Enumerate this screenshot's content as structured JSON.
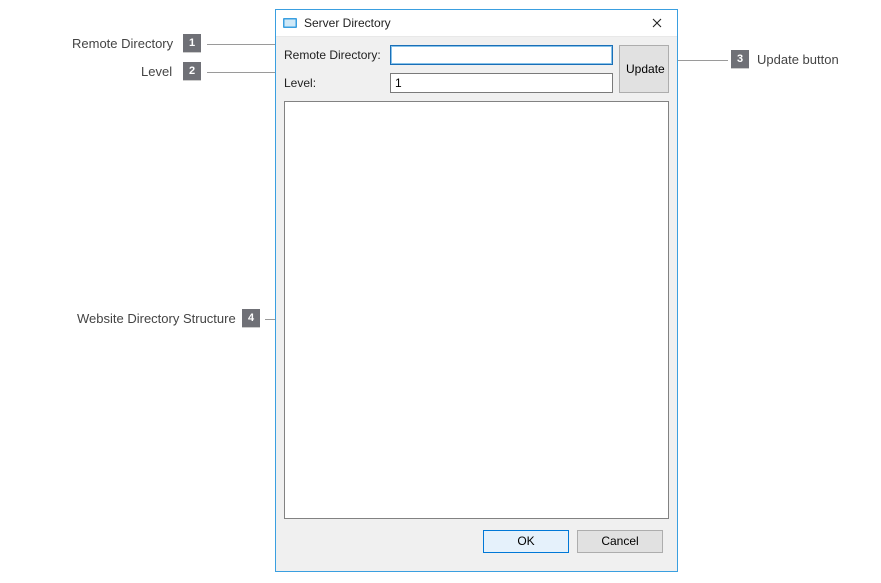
{
  "callouts": {
    "c1": {
      "num": "1",
      "label": "Remote Directory"
    },
    "c2": {
      "num": "2",
      "label": "Level"
    },
    "c3": {
      "num": "3",
      "label": "Update button"
    },
    "c4": {
      "num": "4",
      "label": "Website Directory Structure"
    }
  },
  "dialog": {
    "title": "Server Directory",
    "remote_dir_label": "Remote Directory:",
    "remote_dir_value": "",
    "level_label": "Level:",
    "level_value": "1",
    "update_label": "Update",
    "ok_label": "OK",
    "cancel_label": "Cancel"
  }
}
